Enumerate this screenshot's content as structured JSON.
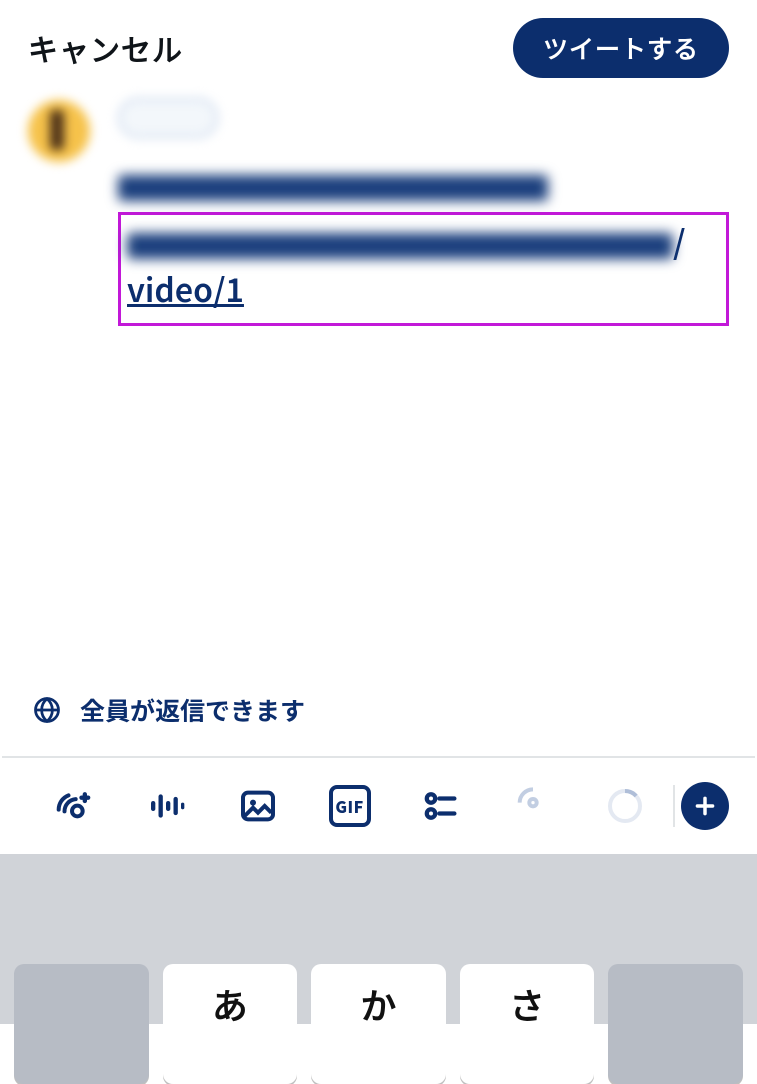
{
  "header": {
    "cancel_label": "キャンセル",
    "tweet_label": "ツイートする"
  },
  "compose": {
    "link_visible_text": "video/1"
  },
  "reply": {
    "label": "全員が返信できます"
  },
  "toolbar": {
    "gif_label": "GIF"
  },
  "keyboard": {
    "keys": [
      "",
      "あ",
      "か",
      "さ",
      ""
    ]
  }
}
